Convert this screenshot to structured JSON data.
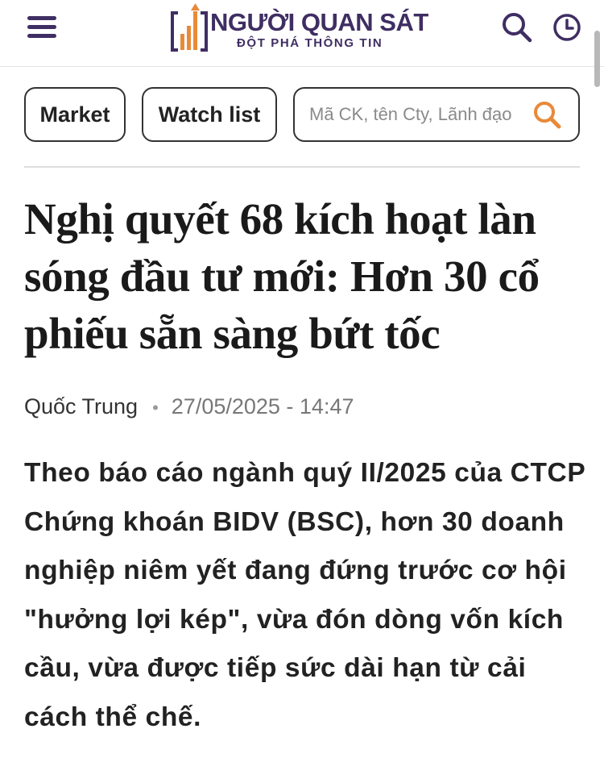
{
  "header": {
    "logo_title": "NGƯỜI QUAN SÁT",
    "logo_tagline": "ĐỘT PHÁ THÔNG TIN",
    "menu_icon": "hamburger-menu-icon",
    "search_icon": "search-icon",
    "clock_icon": "clock-icon"
  },
  "toolbar": {
    "market_label": "Market",
    "watchlist_label": "Watch list",
    "search_placeholder": "Mã CK, tên Cty, Lãnh đạo",
    "search_value": "",
    "search_button_icon": "search-icon"
  },
  "article": {
    "title": "Nghị quyết 68 kích hoạt làn sóng đầu tư mới: Hơn 30 cổ phiếu sẵn sàng bứt tốc",
    "author": "Quốc Trung",
    "separator": "•",
    "datetime": "27/05/2025 - 14:47",
    "sapo": "Theo báo cáo ngành quý II/2025 của CTCP Chứng khoán BIDV (BSC), hơn 30 doanh nghiệp niêm yết đang đứng trước cơ hội \"hưởng lợi kép\", vừa đón dòng vốn kích cầu, vừa được tiếp sức dài hạn từ cải cách thể chế."
  },
  "colors": {
    "brand": "#3f2e63",
    "accent": "#e88a3a",
    "border": "#333333",
    "divider": "#dedede"
  }
}
